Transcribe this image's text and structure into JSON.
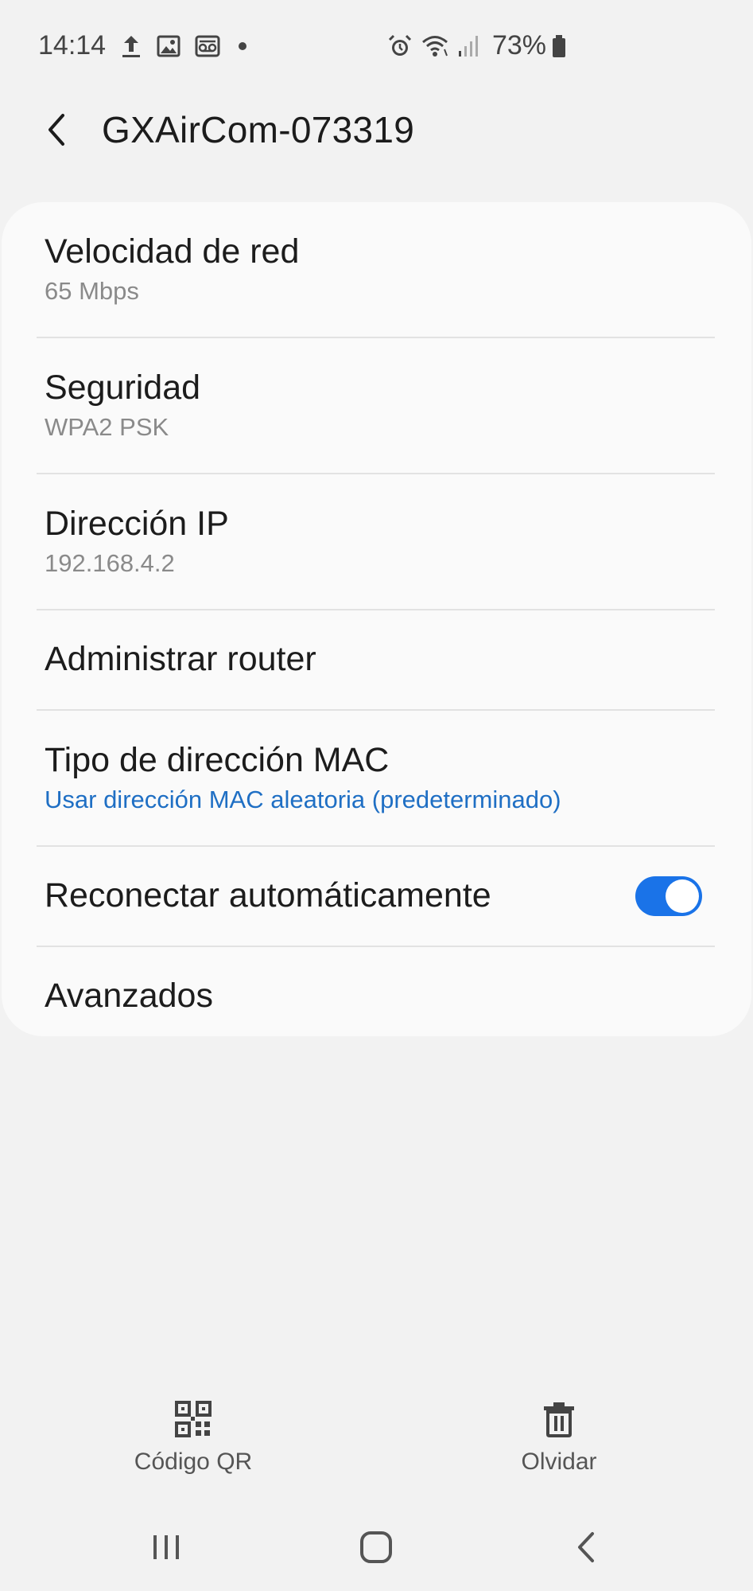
{
  "status_bar": {
    "time": "14:14",
    "battery_percent": "73%",
    "icons_left": [
      "upload-icon",
      "image-icon",
      "voicemail-icon",
      "dot-icon"
    ],
    "icons_right": [
      "alarm-icon",
      "wifi-icon",
      "signal-icon",
      "battery-icon"
    ]
  },
  "header": {
    "back_icon": "back-arrow-icon",
    "title": "GXAirCom-073319"
  },
  "settings": [
    {
      "title": "Velocidad de red",
      "subtitle": "65 Mbps"
    },
    {
      "title": "Seguridad",
      "subtitle": "WPA2 PSK"
    },
    {
      "title": "Dirección IP",
      "subtitle": "192.168.4.2"
    },
    {
      "title": "Administrar router"
    },
    {
      "title": "Tipo de dirección MAC",
      "subtitle": "Usar dirección MAC aleatoria (predeterminado)"
    },
    {
      "title": "Reconectar automáticamente",
      "toggle_on": true
    },
    {
      "title": "Avanzados"
    }
  ],
  "colors": {
    "accent": "#1a73e8",
    "link_text": "#1f6fc4",
    "background": "#f2f2f2",
    "card": "#fafafa"
  },
  "bottom_actions": [
    {
      "label": "Código QR",
      "icon": "qr-code-icon"
    },
    {
      "label": "Olvidar",
      "icon": "trash-icon"
    }
  ],
  "nav_bar": {
    "icons": [
      "recent-apps-icon",
      "home-icon",
      "back-icon"
    ]
  }
}
